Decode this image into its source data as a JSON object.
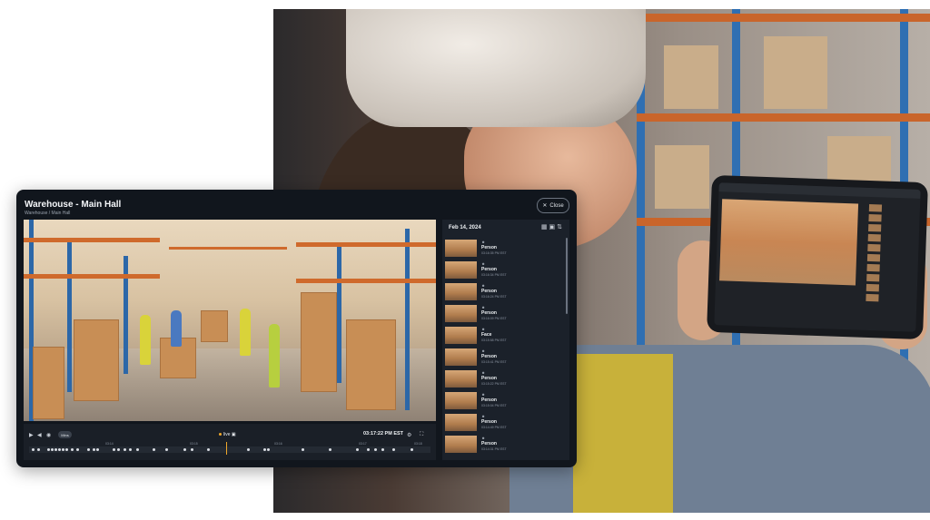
{
  "window": {
    "title": "Warehouse - Main Hall",
    "subtitle": "Warehouse / Main Hall",
    "close_label": "Close"
  },
  "player": {
    "mins_label": "Mins",
    "live_label": "live",
    "current_time": "03:17:22 PM EST",
    "ticks": [
      "03:14",
      "03:15",
      "03:16",
      "03:17",
      "03:18"
    ]
  },
  "panel": {
    "date": "Feb 14, 2024",
    "events": [
      {
        "label": "Person",
        "time": "03:16:35 PM EST"
      },
      {
        "label": "Person",
        "time": "03:16:34 PM EST"
      },
      {
        "label": "Person",
        "time": "03:16:24 PM EST"
      },
      {
        "label": "Person",
        "time": "03:16:09 PM EST"
      },
      {
        "label": "Face",
        "time": "03:15:58 PM EST"
      },
      {
        "label": "Person",
        "time": "03:15:41 PM EST"
      },
      {
        "label": "Person",
        "time": "03:15:22 PM EST"
      },
      {
        "label": "Person",
        "time": "03:15:04 PM EST"
      },
      {
        "label": "Person",
        "time": "03:14:49 PM EST"
      },
      {
        "label": "Person",
        "time": "03:14:31 PM EST"
      }
    ]
  },
  "colors": {
    "accent": "#f0a82a",
    "window_bg": "#11161d",
    "panel_bg": "#1b212a"
  },
  "icons": [
    "close-icon",
    "play-icon",
    "volume-icon",
    "camera-icon",
    "calendar-icon",
    "grid-icon",
    "filter-icon",
    "settings-icon",
    "fullscreen-icon",
    "person-icon"
  ]
}
